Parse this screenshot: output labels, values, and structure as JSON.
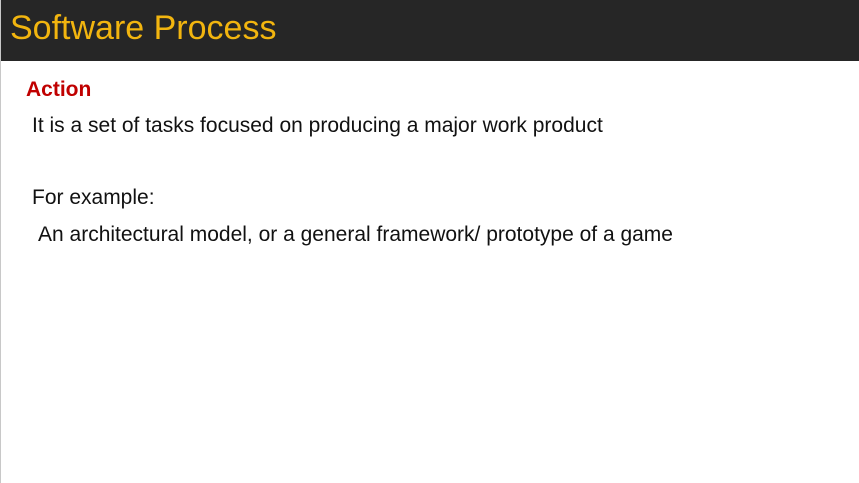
{
  "slide": {
    "title": "Software Process",
    "heading": "Action",
    "definition": "It is a set of tasks focused on producing a major work product",
    "example_label": "For example:",
    "example_text": "An architectural model, or a general framework/ prototype of a game"
  },
  "colors": {
    "title_bar": "#262626",
    "title_text": "#f2b50f",
    "heading": "#c00000",
    "body_text": "#111111",
    "background": "#ffffff"
  }
}
